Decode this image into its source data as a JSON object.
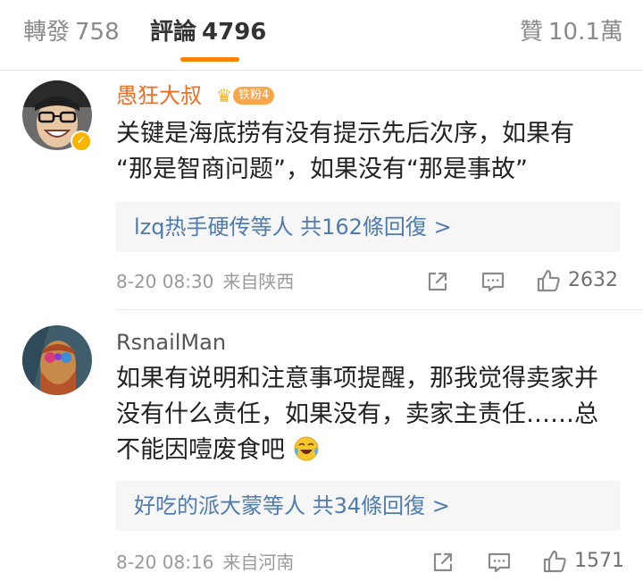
{
  "tabs": {
    "reposts": {
      "label": "轉發",
      "count": "758"
    },
    "comments": {
      "label": "評論",
      "count": "4796"
    },
    "likes": {
      "label": "贊",
      "count": "10.1萬"
    }
  },
  "accent_color": "#ff8200",
  "link_color": "#4f7cae",
  "comments": [
    {
      "username": "愚狂大叔",
      "badge": "铁粉4",
      "verified": true,
      "text_line1": "关键是海底捞有没有提示先后次序，如果有",
      "text_line2": "“那是智商问题”，如果没有“那是事故”",
      "replies": "lzq热手硬传等人 共162條回復 >",
      "time": "8-20 08:30",
      "location": "来自陕西",
      "likes": "2632"
    },
    {
      "username": "RsnailMan",
      "text_line1": "如果有说明和注意事项提醒，那我觉得卖家并",
      "text_line2": "没有什么责任，如果没有，卖家主责任……总",
      "text_line3": "不能因噎废食吧",
      "emoji": "laugh-cry-emoji",
      "replies": "好吃的派大蒙等人 共34條回復 >",
      "time": "8-20 08:16",
      "location": "来自河南",
      "likes": "1571"
    }
  ]
}
